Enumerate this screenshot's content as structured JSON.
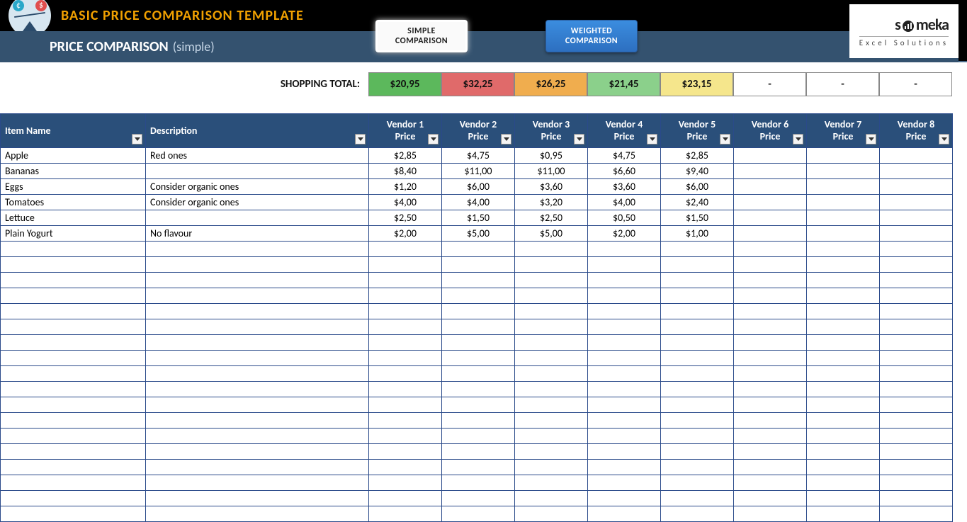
{
  "header": {
    "title": "BASIC PRICE COMPARISON TEMPLATE",
    "subtitle_main": "PRICE COMPARISON",
    "subtitle_paren": "(simple)",
    "buttons": {
      "simple_line1": "SIMPLE",
      "simple_line2": "COMPARISON",
      "weighted_line1": "WEIGHTED",
      "weighted_line2": "COMPARISON"
    },
    "logo": {
      "name": "someka",
      "tagline": "Excel Solutions"
    }
  },
  "totals": {
    "label": "SHOPPING TOTAL:",
    "values": [
      "$20,95",
      "$32,25",
      "$26,25",
      "$21,45",
      "$23,15",
      "-",
      "-",
      "-"
    ],
    "colors": [
      "c-green",
      "c-red",
      "c-orange",
      "c-lgreen",
      "c-yellow",
      "c-none",
      "c-none",
      "c-none"
    ]
  },
  "columns": {
    "item": "Item Name",
    "description": "Description",
    "price_word": "Price",
    "vendors": [
      "Vendor 1",
      "Vendor 2",
      "Vendor 3",
      "Vendor 4",
      "Vendor 5",
      "Vendor 6",
      "Vendor 7",
      "Vendor 8"
    ]
  },
  "rows": [
    {
      "item": "Apple",
      "desc": "Red ones",
      "prices": [
        "$2,85",
        "$4,75",
        "$0,95",
        "$4,75",
        "$2,85",
        "",
        "",
        ""
      ]
    },
    {
      "item": "Bananas",
      "desc": "",
      "prices": [
        "$8,40",
        "$11,00",
        "$11,00",
        "$6,60",
        "$9,40",
        "",
        "",
        ""
      ]
    },
    {
      "item": "Eggs",
      "desc": "Consider organic ones",
      "prices": [
        "$1,20",
        "$6,00",
        "$3,60",
        "$3,60",
        "$6,00",
        "",
        "",
        ""
      ]
    },
    {
      "item": "Tomatoes",
      "desc": "Consider organic ones",
      "prices": [
        "$4,00",
        "$4,00",
        "$3,20",
        "$4,00",
        "$2,40",
        "",
        "",
        ""
      ]
    },
    {
      "item": "Lettuce",
      "desc": "",
      "prices": [
        "$2,50",
        "$1,50",
        "$2,50",
        "$0,50",
        "$1,50",
        "",
        "",
        ""
      ]
    },
    {
      "item": "Plain Yogurt",
      "desc": "No flavour",
      "prices": [
        "$2,00",
        "$5,00",
        "$5,00",
        "$2,00",
        "$1,00",
        "",
        "",
        ""
      ]
    }
  ],
  "empty_row_count": 18
}
